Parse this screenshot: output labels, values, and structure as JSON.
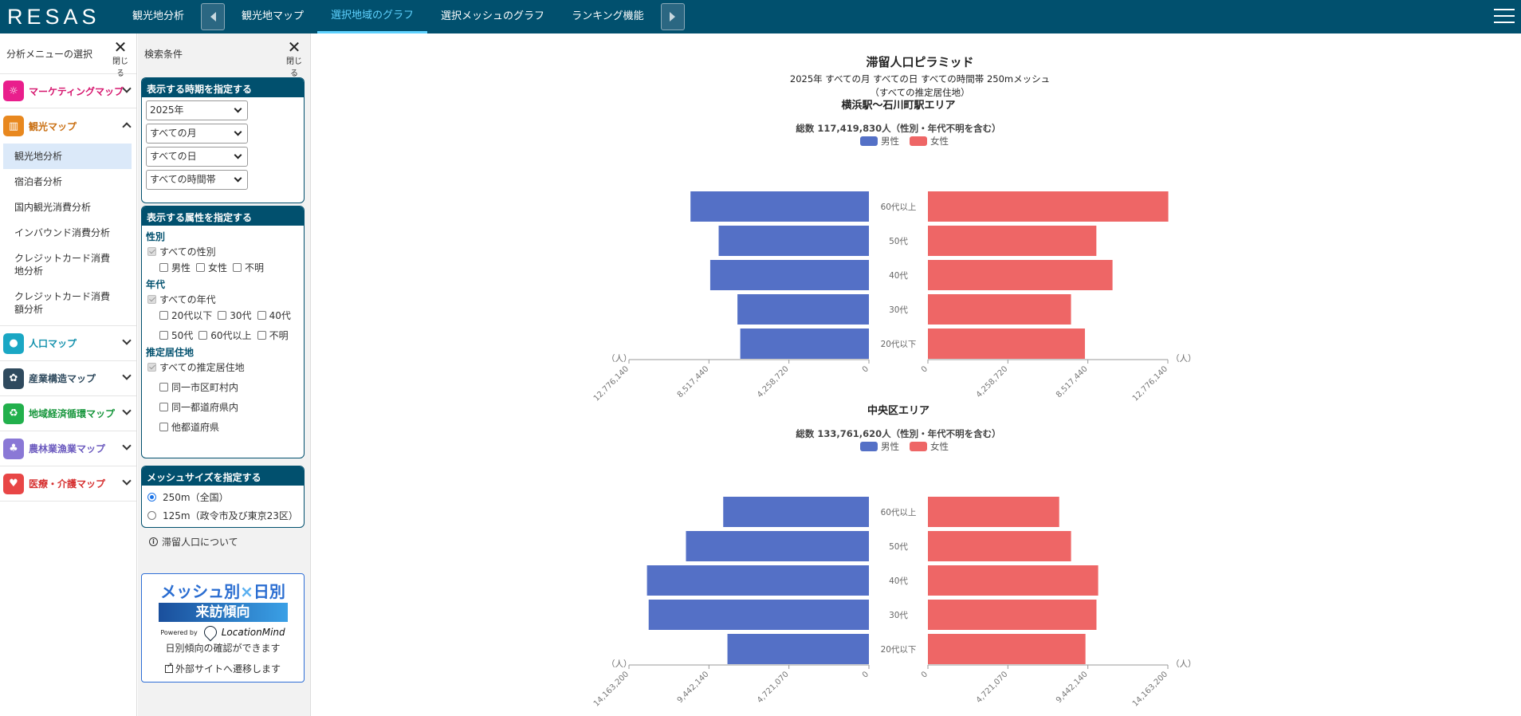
{
  "header": {
    "logo": "RESAS",
    "nav": [
      "観光地分析",
      "観光地マップ",
      "選択地域のグラフ",
      "選択メッシュのグラフ",
      "ランキング機能"
    ],
    "active_index": 2
  },
  "left_menu": {
    "title": "分析メニューの選択",
    "close_label": "閉じる",
    "categories": [
      {
        "label": "マーケティングマップ",
        "color": "#e91e8c",
        "text_color": "#d6176f",
        "icon": "lightbulb-icon",
        "glyph": "☼"
      },
      {
        "label": "観光マップ",
        "color": "#e8881f",
        "text_color": "#c96f12",
        "icon": "map-icon",
        "glyph": "▥"
      },
      {
        "label": "人口マップ",
        "color": "#1aa7c4",
        "text_color": "#1592ad",
        "icon": "people-icon",
        "glyph": "●"
      },
      {
        "label": "産業構造マップ",
        "color": "#2f4a5e",
        "text_color": "#2f4a5e",
        "icon": "gears-icon",
        "glyph": "✿"
      },
      {
        "label": "地域経済循環マップ",
        "color": "#22b04c",
        "text_color": "#17963c",
        "icon": "recycle-icon",
        "glyph": "♻"
      },
      {
        "label": "農林業漁業マップ",
        "color": "#8a78d6",
        "text_color": "#6c5bbf",
        "icon": "tree-icon",
        "glyph": "♣"
      },
      {
        "label": "医療・介護マップ",
        "color": "#e84646",
        "text_color": "#d63030",
        "icon": "heart-pulse-icon",
        "glyph": "♥"
      }
    ],
    "sub_items": [
      "観光地分析",
      "宿泊者分析",
      "国内観光消費分析",
      "インバウンド消費分析",
      "クレジットカード消費地分析",
      "クレジットカード消費額分析"
    ]
  },
  "conditions": {
    "title": "検索条件",
    "close_label": "閉じる",
    "period": {
      "header": "表示する時期を指定する",
      "year": "2025年",
      "month": "すべての月",
      "day": "すべての日",
      "time": "すべての時間帯"
    },
    "attributes": {
      "header": "表示する属性を指定する",
      "gender_label": "性別",
      "gender_all": "すべての性別",
      "gender_opts": [
        "男性",
        "女性",
        "不明"
      ],
      "age_label": "年代",
      "age_all": "すべての年代",
      "age_opts_1": [
        "20代以下",
        "30代",
        "40代"
      ],
      "age_opts_2": [
        "50代",
        "60代以上",
        "不明"
      ],
      "residence_label": "推定居住地",
      "residence_all": "すべての推定居住地",
      "residence_opts": [
        "同一市区町村内",
        "同一都道府県内",
        "他都道府県"
      ]
    },
    "mesh": {
      "header": "メッシュサイズを指定する",
      "opt1": "250m（全国）",
      "opt2": "125m（政令市及び東京23区）"
    },
    "info": "滞留人口について",
    "banner": {
      "line1a": "メッシュ別",
      "line1b": "×",
      "line1c": "日別",
      "line2": "来訪傾向",
      "powered": "Powered by",
      "brand": "LocationMind",
      "line4": "日別傾向の確認ができます",
      "line5": "外部サイトへ遷移します"
    }
  },
  "main": {
    "title": "滞留人口ピラミッド",
    "subtitle1": "2025年 すべての月 すべての日 すべての時間帯 250mメッシュ",
    "subtitle2": "（すべての推定居住地）"
  },
  "chart_data": [
    {
      "type": "bar",
      "subtype": "population-pyramid",
      "title": "横浜駅～石川町駅エリア",
      "total_label": "総数 117,419,830人（性別・年代不明を含む）",
      "categories": [
        "60代以上",
        "50代",
        "40代",
        "30代",
        "20代以下"
      ],
      "series": [
        {
          "name": "男性",
          "color": "#5470c6",
          "values": [
            9500000,
            8000000,
            8450000,
            7000000,
            6850000
          ]
        },
        {
          "name": "女性",
          "color": "#ee6666",
          "values": [
            12800000,
            8970000,
            9830000,
            7620000,
            8360000
          ]
        }
      ],
      "axis_max": 12776140,
      "ticks": [
        "12,776,140",
        "8,517,440",
        "4,258,720",
        "0"
      ],
      "unit": "（人）"
    },
    {
      "type": "bar",
      "subtype": "population-pyramid",
      "title": "中央区エリア",
      "total_label": "総数 133,761,620人（性別・年代不明を含む）",
      "categories": [
        "60代以上",
        "50代",
        "40代",
        "30代",
        "20代以下"
      ],
      "series": [
        {
          "name": "男性",
          "color": "#5470c6",
          "values": [
            8600000,
            10800000,
            13100000,
            13000000,
            8350000
          ]
        },
        {
          "name": "女性",
          "color": "#ee6666",
          "values": [
            7750000,
            8450000,
            10050000,
            9950000,
            9300000
          ]
        }
      ],
      "axis_max": 14163200,
      "ticks": [
        "14,163,200",
        "9,442,140",
        "4,721,070",
        "0"
      ],
      "unit": "（人）"
    }
  ]
}
